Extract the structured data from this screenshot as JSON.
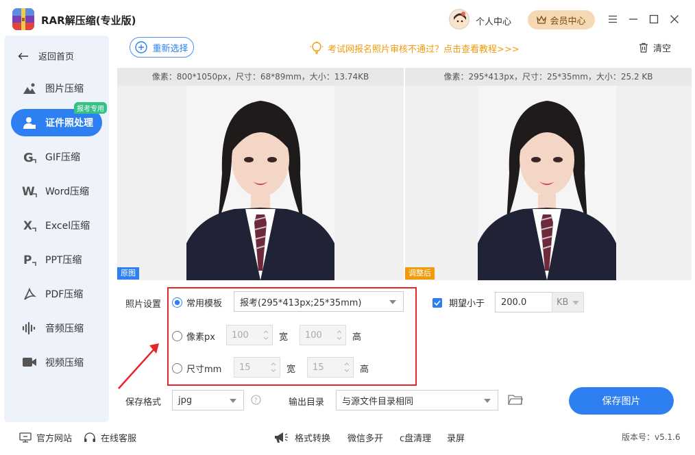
{
  "app": {
    "title": "RAR解压缩(专业版)"
  },
  "header": {
    "user_center": "个人中心",
    "vip_center": "会员中心"
  },
  "sidebar": {
    "back": "返回首页",
    "badge": "报考专用",
    "items": [
      {
        "label": "图片压缩"
      },
      {
        "label": "证件照处理"
      },
      {
        "label": "GIF压缩"
      },
      {
        "label": "Word压缩"
      },
      {
        "label": "Excel压缩"
      },
      {
        "label": "PPT压缩"
      },
      {
        "label": "PDF压缩"
      },
      {
        "label": "音频压缩"
      },
      {
        "label": "视频压缩"
      }
    ]
  },
  "toolbar": {
    "reselect": "重新选择",
    "notice": "考试网报名照片审核不通过？点击查看教程>>>",
    "clear": "清空"
  },
  "preview": {
    "original_meta": "像素：800*1050px，尺寸：68*89mm，大小：13.74KB",
    "original_tag": "原图",
    "adjusted_meta": "像素：295*413px，尺寸：25*35mm，大小：25.2 KB",
    "adjusted_tag": "调整后"
  },
  "settings": {
    "label": "照片设置",
    "template_label": "常用模板",
    "template_value": "报考(295*413px;25*35mm)",
    "pixel_label": "像素px",
    "pixel_width": "100",
    "pixel_height": "100",
    "size_label": "尺寸mm",
    "size_width": "15",
    "size_height": "15",
    "width_label": "宽",
    "height_label": "高",
    "expect_label": "期望小于",
    "expect_value": "200.0",
    "expect_unit": "KB"
  },
  "save": {
    "format_label": "保存格式",
    "format_value": "jpg",
    "output_label": "输出目录",
    "output_value": "与源文件目录相同",
    "save_button": "保存图片"
  },
  "footer": {
    "website": "官方网站",
    "support": "在线客服",
    "format_convert": "格式转换",
    "wechat_multi": "微信多开",
    "c_clean": "c盘清理",
    "record": "录屏",
    "version": "版本号：v5.1.6"
  },
  "colors": {
    "accent": "#2d7ff2",
    "notice": "#f29b0a",
    "highlight": "#e8242b",
    "badge": "#36c287"
  }
}
